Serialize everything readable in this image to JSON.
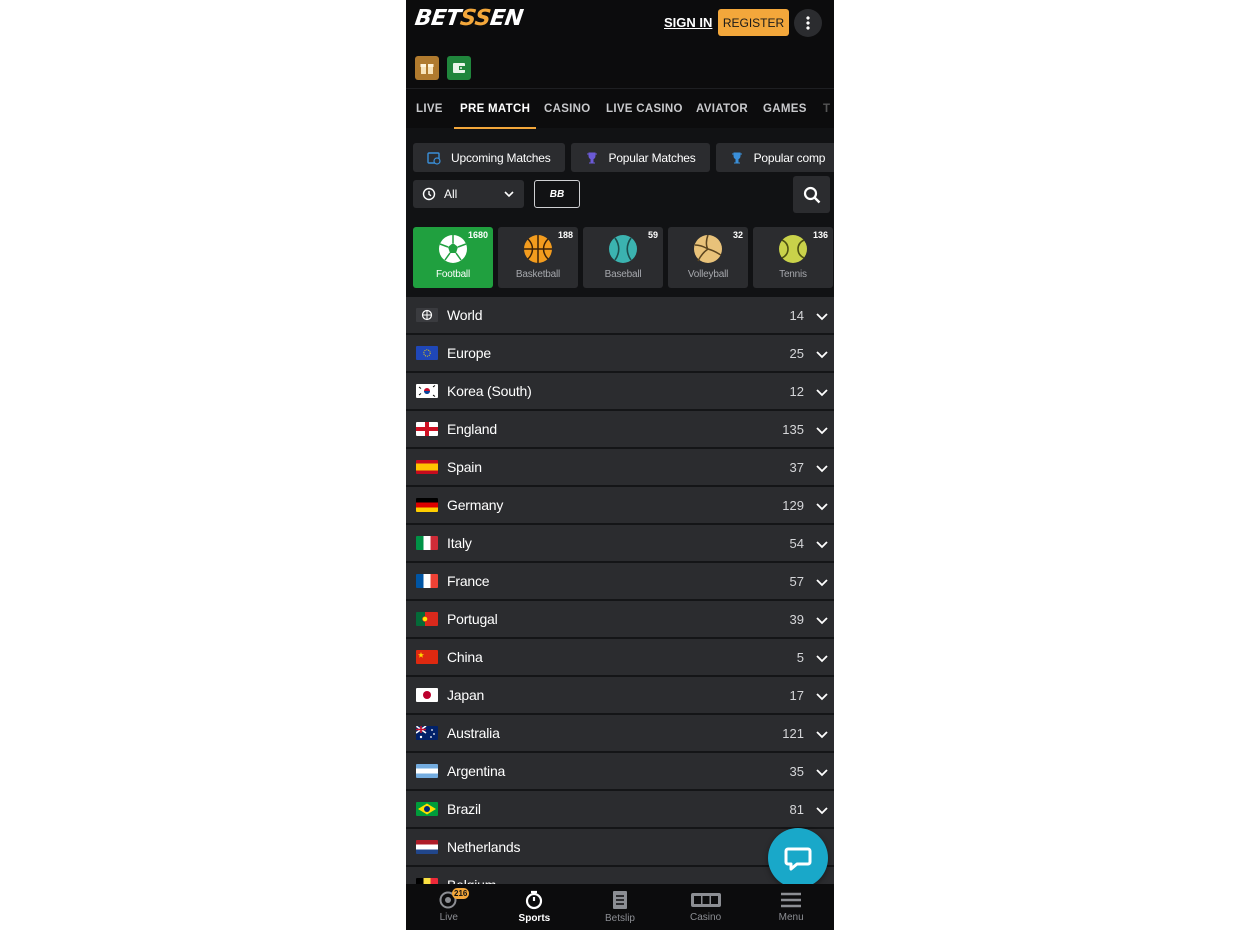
{
  "header": {
    "logo_prefix": "BET",
    "logo_accent": "SS",
    "logo_suffix": "EN",
    "signin_label": "SIGN IN",
    "register_label": "REGISTER",
    "brand_color": "#f3a73b"
  },
  "nav": {
    "tabs": [
      {
        "label": "LIVE"
      },
      {
        "label": "PRE MATCH",
        "active": true
      },
      {
        "label": "CASINO"
      },
      {
        "label": "LIVE CASINO"
      },
      {
        "label": "AVIATOR"
      },
      {
        "label": "GAMES"
      },
      {
        "label": "T"
      }
    ]
  },
  "chips": [
    {
      "label": "Upcoming Matches",
      "icon": "calendar-clock-icon"
    },
    {
      "label": "Popular Matches",
      "icon": "trophy-icon"
    },
    {
      "label": "Popular comp",
      "icon": "trophy-icon"
    }
  ],
  "filters": {
    "time_value": "All",
    "bb_label": "BB"
  },
  "sports": [
    {
      "name": "Football",
      "count": "1680",
      "active": true,
      "icon": "football-icon",
      "color": "#ffffff"
    },
    {
      "name": "Basketball",
      "count": "188",
      "icon": "basketball-icon",
      "color": "#f39c1e"
    },
    {
      "name": "Baseball",
      "count": "59",
      "icon": "baseball-icon",
      "color": "#3bb3b0"
    },
    {
      "name": "Volleyball",
      "count": "32",
      "icon": "volleyball-icon",
      "color": "#e8c27a"
    },
    {
      "name": "Tennis",
      "count": "136",
      "icon": "tennis-icon",
      "color": "#c9d24a"
    }
  ],
  "countries": [
    {
      "name": "World",
      "count": "14",
      "flag": "world"
    },
    {
      "name": "Europe",
      "count": "25",
      "flag": "eu"
    },
    {
      "name": "Korea (South)",
      "count": "12",
      "flag": "kr"
    },
    {
      "name": "England",
      "count": "135",
      "flag": "en"
    },
    {
      "name": "Spain",
      "count": "37",
      "flag": "es"
    },
    {
      "name": "Germany",
      "count": "129",
      "flag": "de"
    },
    {
      "name": "Italy",
      "count": "54",
      "flag": "it"
    },
    {
      "name": "France",
      "count": "57",
      "flag": "fr"
    },
    {
      "name": "Portugal",
      "count": "39",
      "flag": "pt"
    },
    {
      "name": "China",
      "count": "5",
      "flag": "cn"
    },
    {
      "name": "Japan",
      "count": "17",
      "flag": "jp"
    },
    {
      "name": "Australia",
      "count": "121",
      "flag": "au"
    },
    {
      "name": "Argentina",
      "count": "35",
      "flag": "ar"
    },
    {
      "name": "Brazil",
      "count": "81",
      "flag": "br"
    },
    {
      "name": "Netherlands",
      "count": "",
      "flag": "nl"
    },
    {
      "name": "Belgium",
      "count": "",
      "flag": "be"
    }
  ],
  "bottom_nav": [
    {
      "label": "Live",
      "icon": "live-icon",
      "badge": "216"
    },
    {
      "label": "Sports",
      "icon": "stopwatch-icon",
      "active": true
    },
    {
      "label": "Betslip",
      "icon": "betslip-icon"
    },
    {
      "label": "Casino",
      "icon": "slot-machine-icon"
    },
    {
      "label": "Menu",
      "icon": "hamburger-menu-icon"
    }
  ]
}
